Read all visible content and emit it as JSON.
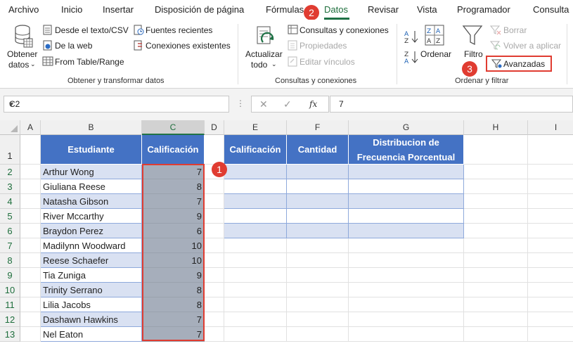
{
  "menu": {
    "tabs": [
      "Archivo",
      "Inicio",
      "Insertar",
      "Disposición de página",
      "Fórmulas",
      "Datos",
      "Revisar",
      "Vista",
      "Programador",
      "Consulta"
    ],
    "active": "Datos"
  },
  "ribbon": {
    "get_data": {
      "button_line1": "Obtener",
      "button_line2": "datos",
      "from_text": "Desde el texto/CSV",
      "from_web": "De la web",
      "from_table": "From Table/Range",
      "recent_sources": "Fuentes recientes",
      "existing_connections": "Conexiones existentes",
      "group_label": "Obtener y transformar datos"
    },
    "queries": {
      "refresh_line1": "Actualizar",
      "refresh_line2": "todo",
      "queries_connections": "Consultas y conexiones",
      "properties": "Propiedades",
      "edit_links": "Editar vínculos",
      "group_label": "Consultas y conexiones"
    },
    "sort_filter": {
      "sort": "Ordenar",
      "filter": "Filtro",
      "clear": "Borrar",
      "reapply": "Volver a aplicar",
      "advanced": "Avanzadas",
      "group_label": "Ordenar y filtrar"
    }
  },
  "formula_bar": {
    "name_box": "C2",
    "formula": "7",
    "fx": "fx"
  },
  "columns": [
    "A",
    "B",
    "C",
    "D",
    "E",
    "F",
    "G",
    "H",
    "I"
  ],
  "rows": [
    "1",
    "2",
    "3",
    "4",
    "5",
    "6",
    "7",
    "8",
    "9",
    "10",
    "11",
    "12",
    "13"
  ],
  "table1": {
    "headers": [
      "Estudiante",
      "Calificación"
    ],
    "rows": [
      [
        "Arthur Wong",
        "7"
      ],
      [
        "Giuliana Reese",
        "8"
      ],
      [
        "Natasha Gibson",
        "7"
      ],
      [
        "River Mccarthy",
        "9"
      ],
      [
        "Braydon Perez",
        "6"
      ],
      [
        "Madilynn Woodward",
        "10"
      ],
      [
        "Reese Schaefer",
        "10"
      ],
      [
        "Tia Zuniga",
        "9"
      ],
      [
        "Trinity Serrano",
        "8"
      ],
      [
        "Lilia Jacobs",
        "8"
      ],
      [
        "Dashawn Hawkins",
        "7"
      ],
      [
        "Nel Eaton",
        "7"
      ]
    ]
  },
  "table2": {
    "headers": [
      "Calificación",
      "Cantidad",
      "Distribucion de",
      "Frecuencia Porcentual"
    ]
  },
  "badges": [
    "1",
    "2",
    "3"
  ],
  "colors": {
    "accent": "#217346",
    "table_header": "#4472c4",
    "table_band": "#d9e1f2",
    "highlight": "#e03c31"
  }
}
